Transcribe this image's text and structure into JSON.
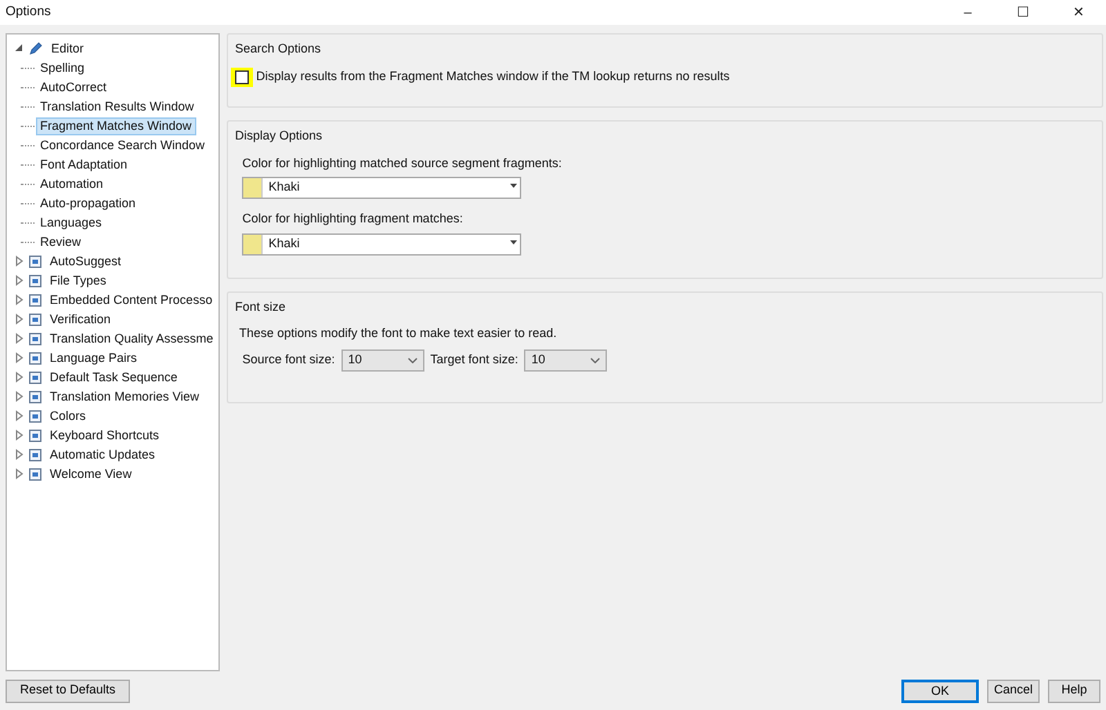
{
  "window": {
    "title": "Options",
    "controls": [
      "–",
      "☐",
      "✕"
    ]
  },
  "tree": [
    {
      "label": "Editor",
      "expanded": true,
      "selected": false,
      "children": [
        {
          "label": "Spelling",
          "selected": false
        },
        {
          "label": "AutoCorrect",
          "selected": false
        },
        {
          "label": "Translation Results Window",
          "selected": false
        },
        {
          "label": "Fragment Matches Window",
          "selected": true
        },
        {
          "label": "Concordance Search Window",
          "selected": false
        },
        {
          "label": "Font Adaptation",
          "selected": false
        },
        {
          "label": "Automation",
          "selected": false
        },
        {
          "label": "Auto-propagation",
          "selected": false
        },
        {
          "label": "Languages",
          "selected": false
        },
        {
          "label": "Review",
          "selected": false
        }
      ]
    },
    {
      "label": "AutoSuggest",
      "expanded": false,
      "selected": false
    },
    {
      "label": "File Types",
      "expanded": false,
      "selected": false
    },
    {
      "label": "Embedded Content Processo",
      "expanded": false,
      "selected": false
    },
    {
      "label": "Verification",
      "expanded": false,
      "selected": false
    },
    {
      "label": "Translation Quality Assessme",
      "expanded": false,
      "selected": false
    },
    {
      "label": "Language Pairs",
      "expanded": false,
      "selected": false
    },
    {
      "label": "Default Task Sequence",
      "expanded": false,
      "selected": false
    },
    {
      "label": "Translation Memories View",
      "expanded": false,
      "selected": false
    },
    {
      "label": "Colors",
      "expanded": false,
      "selected": false
    },
    {
      "label": "Keyboard Shortcuts",
      "expanded": false,
      "selected": false
    },
    {
      "label": "Automatic Updates",
      "expanded": false,
      "selected": false
    },
    {
      "label": "Welcome View",
      "expanded": false,
      "selected": false
    }
  ],
  "search_options": {
    "title": "Search Options",
    "checkbox": {
      "label": "Display results from the Fragment Matches window if the TM lookup returns no results",
      "checked": false
    }
  },
  "display_options": {
    "title": "Display Options",
    "combos": [
      {
        "label": "Color for highlighting matched source segment fragments:",
        "value": "Khaki",
        "color": "#f0e68c"
      },
      {
        "label": "Color for highlighting fragment matches:",
        "value": "Khaki",
        "color": "#f0e68c"
      }
    ]
  },
  "font_size": {
    "title": "Font size",
    "description": "These options modify the font to make text easier to read.",
    "fields": [
      {
        "label": "Source font size:",
        "value": "10"
      },
      {
        "label": "Target font size:",
        "value": "10"
      }
    ]
  },
  "buttons": {
    "reset": "Reset to Defaults",
    "actions": [
      {
        "label": "OK",
        "default": true
      },
      {
        "label": "Cancel",
        "default": false
      },
      {
        "label": "Help",
        "default": false
      }
    ]
  }
}
